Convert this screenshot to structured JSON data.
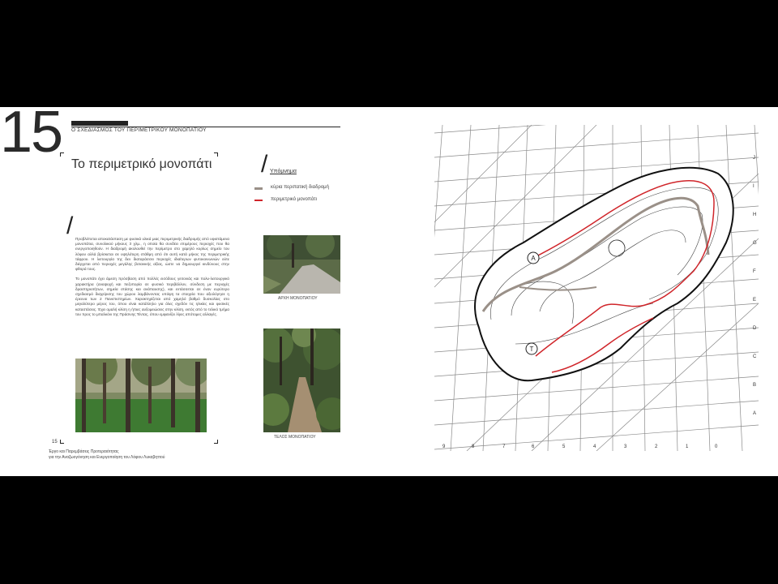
{
  "page_number": "15",
  "section_title": "Ο ΣΧΕΔΙΑΣΜΟΣ ΤΟΥ ΠΕΡΙΜΕΤΡΙΚΟΥ ΜΟΝΟΠΑΤΙΟΥ",
  "main_title": "Το περιμετρικό μονοπάτι",
  "legend": {
    "title": "Υπόμνημα",
    "items": [
      {
        "label": "κύρια περιπατική διαδρομή",
        "color": "#9a9088"
      },
      {
        "label": "περιμετρικό μονοπάτι",
        "color": "#d0252a"
      }
    ]
  },
  "body_paragraphs": [
    "Προβλέπεται αποκατάσταση με φυσικά υλικά μιας περιμετρικής διαδρομής από υφιστάμενα μονοπάτια, συνολικού μήκους 3 χλμ., η οποία θα συνδέει επιμέρους περιοχές που θα ενεργοποιηθούν. Η διαδρομή ακολουθεί την περίμετρο στο χαμηλό κυρίως σημείο του λόφου αλλά βρίσκεται σε υψηλότερη στάθμη από ότι αυτή κατά μήκος της περιμετρικής τάφρου. Η λειτουργία της δεν διαταράσσει περιοχές ιδιαίτερων φυτοκοινωνιών ούτε διέρχεται από περιοχές μεγάλης βοτανικής αξίας, ώστε να δημιουργεί κινδύνους στην φθορά τους.",
    "Το μονοπάτι έχει άμεση πρόσβαση από πολλές εισόδους γειτονιάς και πολυ-λειτουργικό χαρακτήρα (αναψυχή και πεζοπορία σε φυσικό περιβάλλον, σύνδεση με περιοχές δραστηριοτήτων, σημεία στάσης και ανάπαυσης), και εντάσσεται σε έναν ευρύτερο σχεδιασμό διαχείρισης του χώρου λαμβάνοντας υπόψη τα στοιχεία που αξιολόγησε η έρευνα των 2 Πανεπιστημίων. Χαρακτηρίζεται από χαμηλό βαθμό δυσκολίας στο μεγαλύτερο μέρος του, όπου είναι κατάλληλο για όλες σχεδόν τις ηλικίες και φυσικές καταστάσεις. Έχει ομαλή κλίση η ήπιες αυξομειώσεις στην κλίση, εκτός από το τελικό τμήμα του προς το μπαλκόνι της Πράσινης Τέντας, όπου εμφανίζει λίγες απότομες αλλαγές."
  ],
  "captions": {
    "start": "ΑΡΧΗ ΜΟΝΟΠΑΤΙΟΥ",
    "end": "ΤΕΛΟΣ ΜΟΝΟΠΑΤΙΟΥ"
  },
  "footer_page": "15",
  "footer_lines": [
    "Έργο και Παρεμβάσεις Προτεραιότητας",
    "για την Αναζωογόνηση και Ενεργοποίηση του Λόφου Λυκαβηττού"
  ],
  "map": {
    "markers": [
      "A",
      "T"
    ],
    "row_labels": [
      "J",
      "I",
      "H",
      "G",
      "F",
      "E",
      "D",
      "C",
      "B",
      "A"
    ],
    "col_labels": [
      "9",
      "8",
      "7",
      "6",
      "5",
      "4",
      "3",
      "2",
      "1",
      "0"
    ]
  }
}
